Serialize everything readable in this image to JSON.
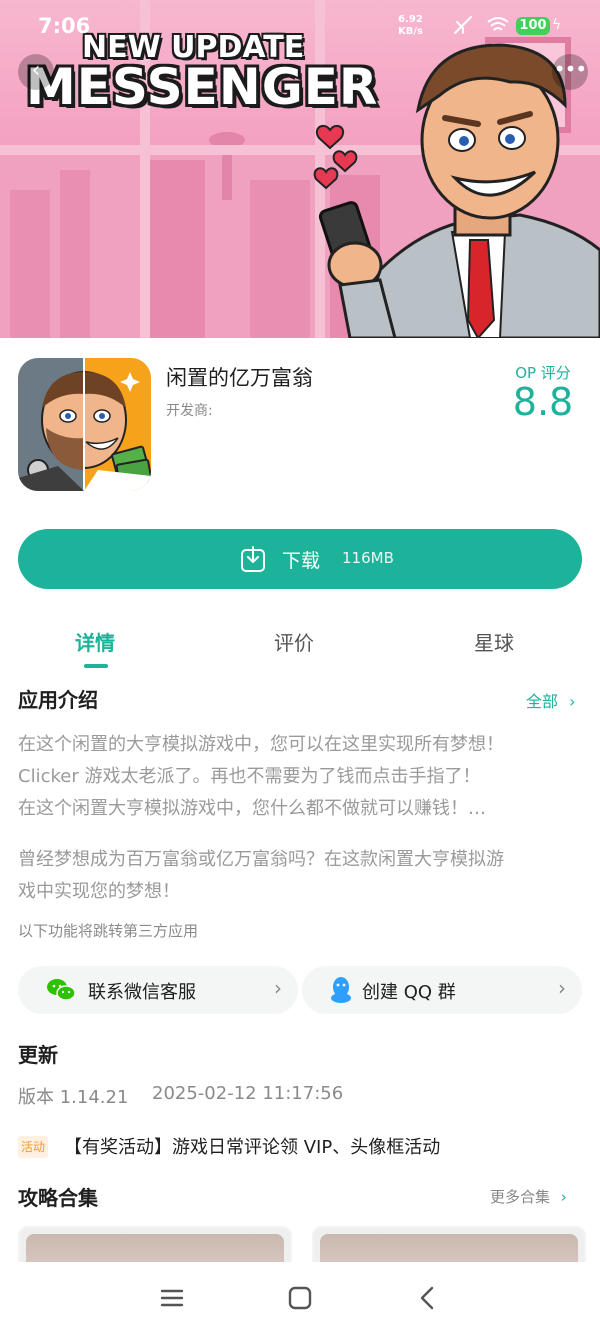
{
  "status_bar": {
    "time": "7:06",
    "net_speed_value": "6.92",
    "net_speed_unit": "KB/s",
    "battery": "100"
  },
  "banner": {
    "logo_line1": "NEW UPDATE",
    "logo_line2": "MESSENGER"
  },
  "app": {
    "name": "闲置的亿万富翁",
    "developer_label": "开发商:",
    "score_label": "OP 评分",
    "score": "8.8"
  },
  "download": {
    "label": "下载",
    "size": "116MB"
  },
  "tabs": [
    {
      "label": "详情",
      "active": true
    },
    {
      "label": "评价",
      "active": false
    },
    {
      "label": "星球",
      "active": false
    }
  ],
  "intro": {
    "title": "应用介绍",
    "more": "全部",
    "lines": [
      "在这个闲置的大亨模拟游戏中，您可以在这里实现所有梦想！",
      "Clicker 游戏太老派了。再也不需要为了钱而点击手指了！",
      "在这个闲置大亨模拟游戏中，您什么都不做就可以赚钱！…"
    ],
    "lines2": [
      "曾经梦想成为百万富翁或亿万富翁吗？在这款闲置大亨模拟游",
      "戏中实现您的梦想！"
    ],
    "third_party_note": "以下功能将跳转第三方应用"
  },
  "contacts": {
    "wechat": "联系微信客服",
    "qq": "创建 QQ 群"
  },
  "update": {
    "title": "更新",
    "version": "版本 1.14.21",
    "date": "2025-02-12 11:17:56"
  },
  "event": {
    "badge": "活动",
    "text": "【有奖活动】游戏日常评论领 VIP、头像框活动"
  },
  "guides": {
    "title": "攻略合集",
    "more": "更多合集"
  },
  "icons": {
    "back": "chevron-left-icon",
    "more": "more-icon",
    "download": "download-icon",
    "wechat": "wechat-icon",
    "qq": "qq-icon"
  },
  "colors": {
    "accent": "#1cb39a",
    "badge_bg": "#fff0e2",
    "badge_text": "#f39a2f"
  }
}
